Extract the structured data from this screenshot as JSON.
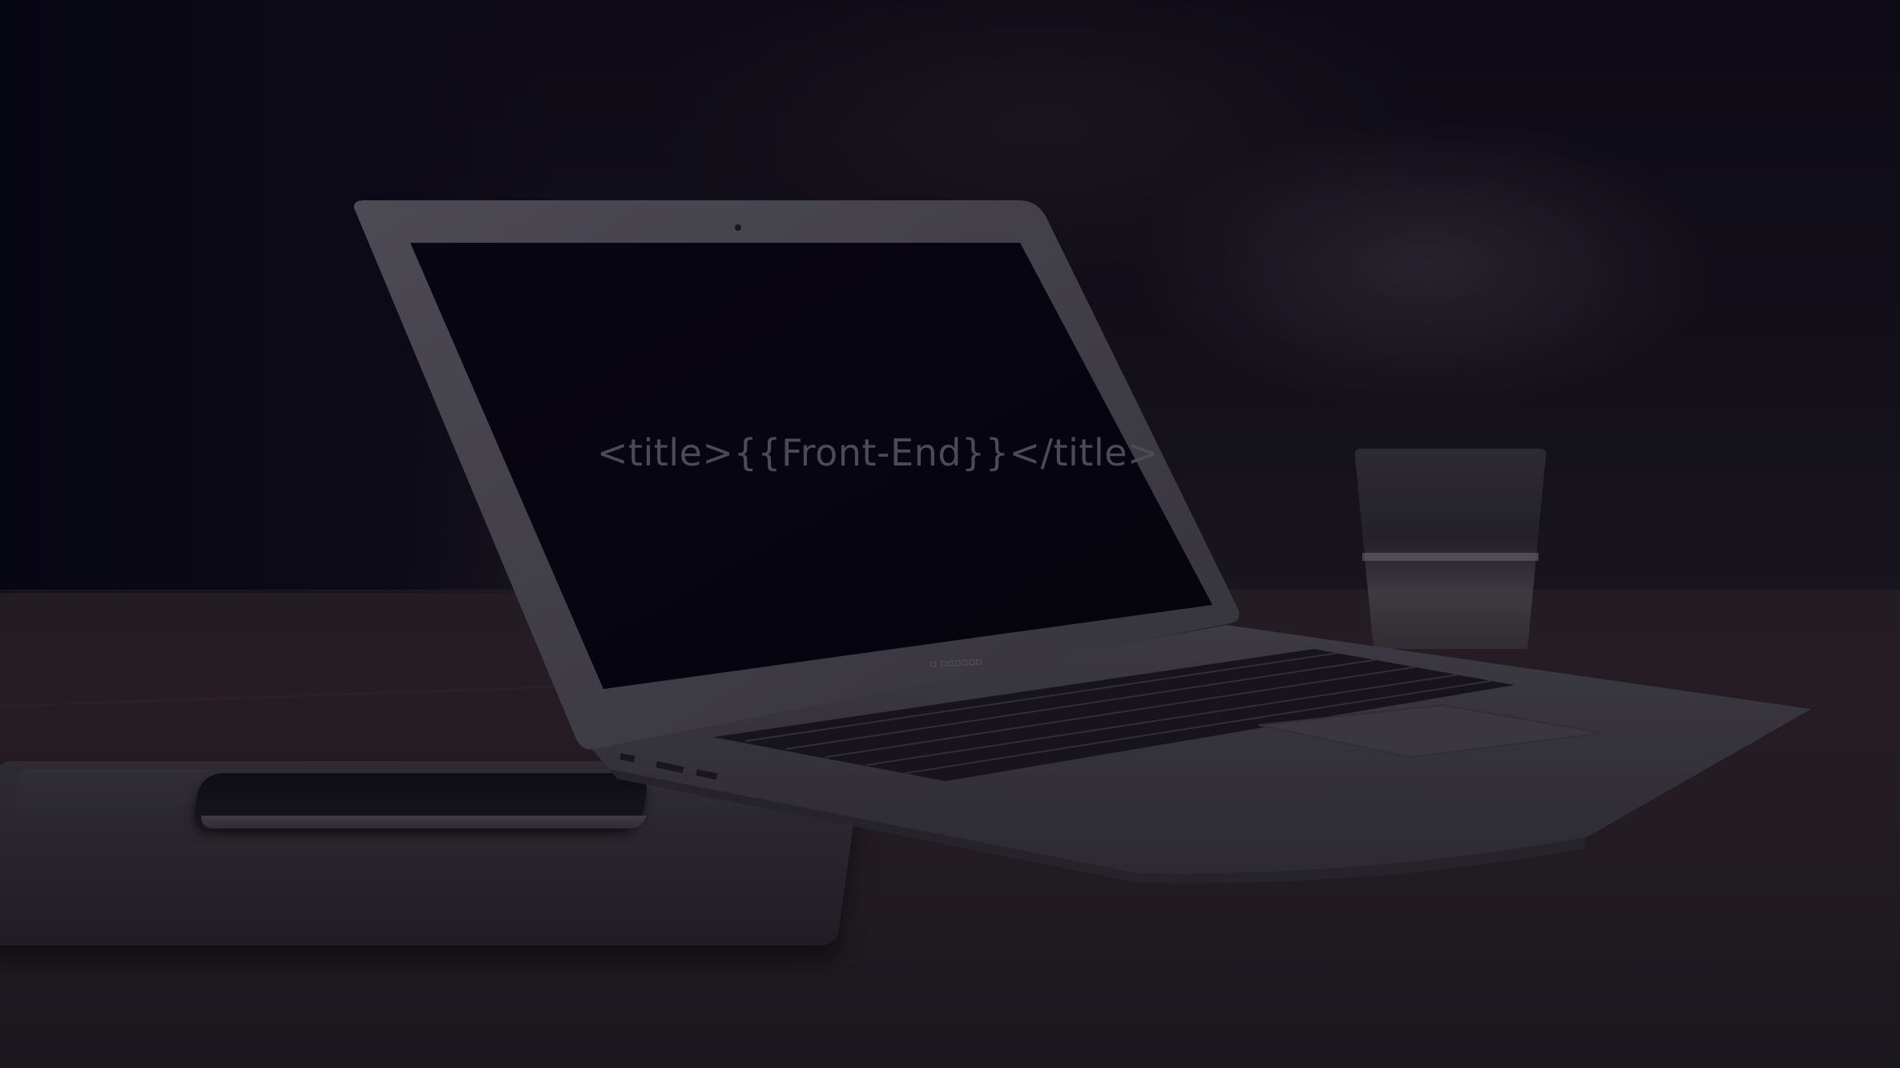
{
  "hero": {
    "code_title": "<title>{{Front-End}}</title>"
  },
  "icons": {
    "laptop": "laptop-icon",
    "phone": "phone-icon",
    "glass": "glass-icon"
  },
  "colors": {
    "background": "#0c0b16",
    "title_text": "#5b5868",
    "laptop_body": "#3a3842",
    "screen": "#07050f",
    "table": "#2a2128"
  }
}
